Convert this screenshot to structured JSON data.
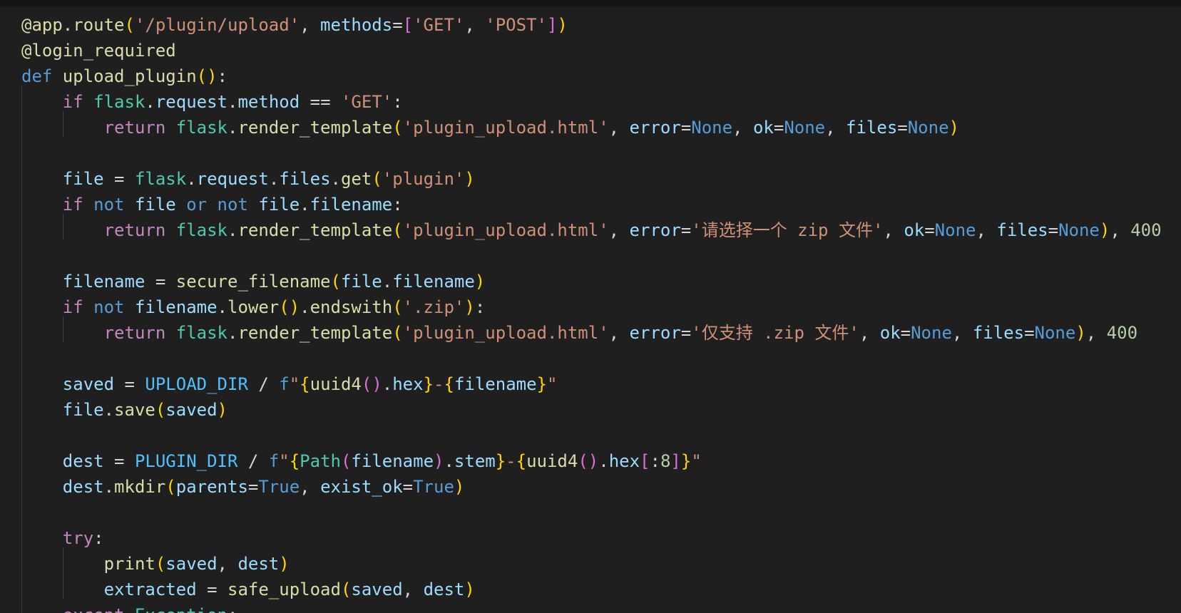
{
  "editor": {
    "language": "python",
    "lines": [
      [
        [
          "dec",
          "@app.route"
        ],
        [
          "b1",
          "("
        ],
        [
          "str",
          "'/plugin/upload'"
        ],
        [
          "plain",
          ", "
        ],
        [
          "var",
          "methods"
        ],
        [
          "plain",
          "="
        ],
        [
          "b2",
          "["
        ],
        [
          "str",
          "'GET'"
        ],
        [
          "plain",
          ", "
        ],
        [
          "str",
          "'POST'"
        ],
        [
          "b2",
          "]"
        ],
        [
          "b1",
          ")"
        ]
      ],
      [
        [
          "dec",
          "@login_required"
        ]
      ],
      [
        [
          "kw",
          "def "
        ],
        [
          "fn",
          "upload_plugin"
        ],
        [
          "b1",
          "()"
        ],
        [
          "plain",
          ":"
        ]
      ],
      [
        [
          "plain",
          "    "
        ],
        [
          "ctl",
          "if "
        ],
        [
          "mod",
          "flask"
        ],
        [
          "plain",
          "."
        ],
        [
          "var",
          "request"
        ],
        [
          "plain",
          "."
        ],
        [
          "var",
          "method"
        ],
        [
          "plain",
          " == "
        ],
        [
          "str",
          "'GET'"
        ],
        [
          "plain",
          ":"
        ]
      ],
      [
        [
          "plain",
          "        "
        ],
        [
          "ctl",
          "return "
        ],
        [
          "mod",
          "flask"
        ],
        [
          "plain",
          "."
        ],
        [
          "fn",
          "render_template"
        ],
        [
          "b1",
          "("
        ],
        [
          "str",
          "'plugin_upload.html'"
        ],
        [
          "plain",
          ", "
        ],
        [
          "var",
          "error"
        ],
        [
          "plain",
          "="
        ],
        [
          "kw",
          "None"
        ],
        [
          "plain",
          ", "
        ],
        [
          "var",
          "ok"
        ],
        [
          "plain",
          "="
        ],
        [
          "kw",
          "None"
        ],
        [
          "plain",
          ", "
        ],
        [
          "var",
          "files"
        ],
        [
          "plain",
          "="
        ],
        [
          "kw",
          "None"
        ],
        [
          "b1",
          ")"
        ]
      ],
      [],
      [
        [
          "plain",
          "    "
        ],
        [
          "var",
          "file"
        ],
        [
          "plain",
          " = "
        ],
        [
          "mod",
          "flask"
        ],
        [
          "plain",
          "."
        ],
        [
          "var",
          "request"
        ],
        [
          "plain",
          "."
        ],
        [
          "var",
          "files"
        ],
        [
          "plain",
          "."
        ],
        [
          "fn",
          "get"
        ],
        [
          "b1",
          "("
        ],
        [
          "str",
          "'plugin'"
        ],
        [
          "b1",
          ")"
        ]
      ],
      [
        [
          "plain",
          "    "
        ],
        [
          "ctl",
          "if "
        ],
        [
          "kw",
          "not "
        ],
        [
          "var",
          "file"
        ],
        [
          "kw",
          " or "
        ],
        [
          "kw",
          "not "
        ],
        [
          "var",
          "file"
        ],
        [
          "plain",
          "."
        ],
        [
          "var",
          "filename"
        ],
        [
          "plain",
          ":"
        ]
      ],
      [
        [
          "plain",
          "        "
        ],
        [
          "ctl",
          "return "
        ],
        [
          "mod",
          "flask"
        ],
        [
          "plain",
          "."
        ],
        [
          "fn",
          "render_template"
        ],
        [
          "b1",
          "("
        ],
        [
          "str",
          "'plugin_upload.html'"
        ],
        [
          "plain",
          ", "
        ],
        [
          "var",
          "error"
        ],
        [
          "plain",
          "="
        ],
        [
          "str",
          "'请选择一个 zip 文件'"
        ],
        [
          "plain",
          ", "
        ],
        [
          "var",
          "ok"
        ],
        [
          "plain",
          "="
        ],
        [
          "kw",
          "None"
        ],
        [
          "plain",
          ", "
        ],
        [
          "var",
          "files"
        ],
        [
          "plain",
          "="
        ],
        [
          "kw",
          "None"
        ],
        [
          "b1",
          ")"
        ],
        [
          "plain",
          ", "
        ],
        [
          "num",
          "400"
        ]
      ],
      [],
      [
        [
          "plain",
          "    "
        ],
        [
          "var",
          "filename"
        ],
        [
          "plain",
          " = "
        ],
        [
          "fn",
          "secure_filename"
        ],
        [
          "b1",
          "("
        ],
        [
          "var",
          "file"
        ],
        [
          "plain",
          "."
        ],
        [
          "var",
          "filename"
        ],
        [
          "b1",
          ")"
        ]
      ],
      [
        [
          "plain",
          "    "
        ],
        [
          "ctl",
          "if "
        ],
        [
          "kw",
          "not "
        ],
        [
          "var",
          "filename"
        ],
        [
          "plain",
          "."
        ],
        [
          "fn",
          "lower"
        ],
        [
          "b1",
          "()"
        ],
        [
          "plain",
          "."
        ],
        [
          "fn",
          "endswith"
        ],
        [
          "b1",
          "("
        ],
        [
          "str",
          "'.zip'"
        ],
        [
          "b1",
          ")"
        ],
        [
          "plain",
          ":"
        ]
      ],
      [
        [
          "plain",
          "        "
        ],
        [
          "ctl",
          "return "
        ],
        [
          "mod",
          "flask"
        ],
        [
          "plain",
          "."
        ],
        [
          "fn",
          "render_template"
        ],
        [
          "b1",
          "("
        ],
        [
          "str",
          "'plugin_upload.html'"
        ],
        [
          "plain",
          ", "
        ],
        [
          "var",
          "error"
        ],
        [
          "plain",
          "="
        ],
        [
          "str",
          "'仅支持 .zip 文件'"
        ],
        [
          "plain",
          ", "
        ],
        [
          "var",
          "ok"
        ],
        [
          "plain",
          "="
        ],
        [
          "kw",
          "None"
        ],
        [
          "plain",
          ", "
        ],
        [
          "var",
          "files"
        ],
        [
          "plain",
          "="
        ],
        [
          "kw",
          "None"
        ],
        [
          "b1",
          ")"
        ],
        [
          "plain",
          ", "
        ],
        [
          "num",
          "400"
        ]
      ],
      [],
      [
        [
          "plain",
          "    "
        ],
        [
          "var",
          "saved"
        ],
        [
          "plain",
          " = "
        ],
        [
          "const",
          "UPLOAD_DIR"
        ],
        [
          "plain",
          " / "
        ],
        [
          "kw",
          "f"
        ],
        [
          "str",
          "\""
        ],
        [
          "b1",
          "{"
        ],
        [
          "fn",
          "uuid4"
        ],
        [
          "b2",
          "()"
        ],
        [
          "plain",
          "."
        ],
        [
          "var",
          "hex"
        ],
        [
          "b1",
          "}"
        ],
        [
          "str",
          "-"
        ],
        [
          "b1",
          "{"
        ],
        [
          "var",
          "filename"
        ],
        [
          "b1",
          "}"
        ],
        [
          "str",
          "\""
        ]
      ],
      [
        [
          "plain",
          "    "
        ],
        [
          "var",
          "file"
        ],
        [
          "plain",
          "."
        ],
        [
          "fn",
          "save"
        ],
        [
          "b1",
          "("
        ],
        [
          "var",
          "saved"
        ],
        [
          "b1",
          ")"
        ]
      ],
      [],
      [
        [
          "plain",
          "    "
        ],
        [
          "var",
          "dest"
        ],
        [
          "plain",
          " = "
        ],
        [
          "const",
          "PLUGIN_DIR"
        ],
        [
          "plain",
          " / "
        ],
        [
          "kw",
          "f"
        ],
        [
          "str",
          "\""
        ],
        [
          "b1",
          "{"
        ],
        [
          "mod",
          "Path"
        ],
        [
          "b2",
          "("
        ],
        [
          "var",
          "filename"
        ],
        [
          "b2",
          ")"
        ],
        [
          "plain",
          "."
        ],
        [
          "var",
          "stem"
        ],
        [
          "b1",
          "}"
        ],
        [
          "str",
          "-"
        ],
        [
          "b1",
          "{"
        ],
        [
          "fn",
          "uuid4"
        ],
        [
          "b2",
          "()"
        ],
        [
          "plain",
          "."
        ],
        [
          "var",
          "hex"
        ],
        [
          "b2",
          "["
        ],
        [
          "plain",
          ":"
        ],
        [
          "num",
          "8"
        ],
        [
          "b2",
          "]"
        ],
        [
          "b1",
          "}"
        ],
        [
          "str",
          "\""
        ]
      ],
      [
        [
          "plain",
          "    "
        ],
        [
          "var",
          "dest"
        ],
        [
          "plain",
          "."
        ],
        [
          "fn",
          "mkdir"
        ],
        [
          "b1",
          "("
        ],
        [
          "var",
          "parents"
        ],
        [
          "plain",
          "="
        ],
        [
          "kw",
          "True"
        ],
        [
          "plain",
          ", "
        ],
        [
          "var",
          "exist_ok"
        ],
        [
          "plain",
          "="
        ],
        [
          "kw",
          "True"
        ],
        [
          "b1",
          ")"
        ]
      ],
      [],
      [
        [
          "plain",
          "    "
        ],
        [
          "ctl",
          "try"
        ],
        [
          "plain",
          ":"
        ]
      ],
      [
        [
          "plain",
          "        "
        ],
        [
          "fn",
          "print"
        ],
        [
          "b1",
          "("
        ],
        [
          "var",
          "saved"
        ],
        [
          "plain",
          ", "
        ],
        [
          "var",
          "dest"
        ],
        [
          "b1",
          ")"
        ]
      ],
      [
        [
          "plain",
          "        "
        ],
        [
          "var",
          "extracted"
        ],
        [
          "plain",
          " = "
        ],
        [
          "fn",
          "safe_upload"
        ],
        [
          "b1",
          "("
        ],
        [
          "var",
          "saved"
        ],
        [
          "plain",
          ", "
        ],
        [
          "var",
          "dest"
        ],
        [
          "b1",
          ")"
        ]
      ],
      [
        [
          "plain",
          "    "
        ],
        [
          "ctl",
          "except "
        ],
        [
          "mod",
          "Exception"
        ],
        [
          "plain",
          ":"
        ]
      ]
    ]
  }
}
